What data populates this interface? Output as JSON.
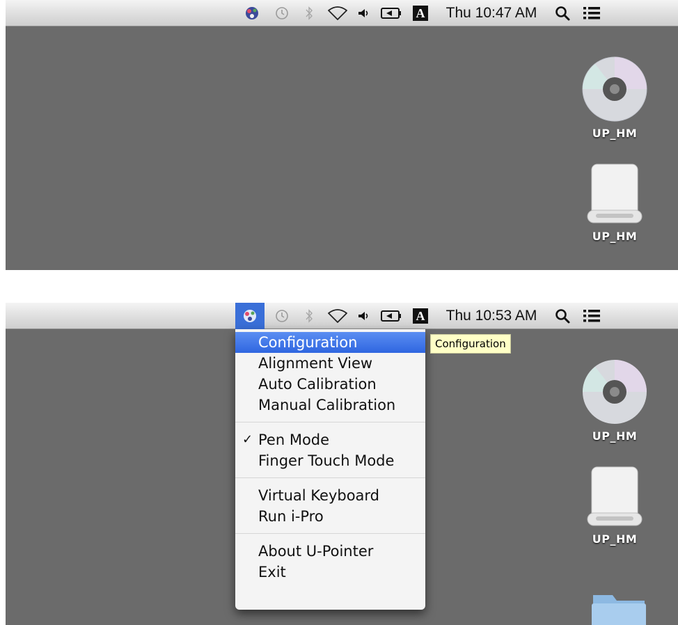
{
  "top_screenshot": {
    "menubar": {
      "icons": [
        "u-pointer-icon",
        "time-machine-icon",
        "bluetooth-icon",
        "wifi-icon",
        "volume-icon",
        "battery-icon",
        "input-source-icon",
        "spotlight-icon",
        "notification-list-icon"
      ],
      "input_source_letter": "A",
      "clock": "Thu 10:47 AM"
    },
    "desktop": [
      {
        "type": "disc-icon",
        "label": "UP_HM"
      },
      {
        "type": "drive-icon",
        "label": "UP_HM"
      }
    ]
  },
  "bottom_screenshot": {
    "menubar": {
      "icons": [
        "u-pointer-icon",
        "time-machine-icon",
        "bluetooth-icon",
        "wifi-icon",
        "volume-icon",
        "battery-icon",
        "input-source-icon",
        "spotlight-icon",
        "notification-list-icon"
      ],
      "input_source_letter": "A",
      "clock": "Thu 10:53 AM",
      "highlighted_icon": "u-pointer-icon"
    },
    "menu": {
      "groups": [
        [
          {
            "label": "Configuration",
            "highlighted": true
          },
          {
            "label": "Alignment View"
          },
          {
            "label": "Auto Calibration"
          },
          {
            "label": "Manual Calibration"
          }
        ],
        [
          {
            "label": "Pen Mode",
            "checked": true,
            "check_glyph": "✓"
          },
          {
            "label": "Finger Touch Mode"
          }
        ],
        [
          {
            "label": "Virtual Keyboard"
          },
          {
            "label": "Run i-Pro"
          }
        ],
        [
          {
            "label": "About U-Pointer"
          },
          {
            "label": "Exit"
          }
        ]
      ]
    },
    "tooltip": "Configuration",
    "desktop": [
      {
        "type": "disc-icon",
        "label": "UP_HM"
      },
      {
        "type": "drive-icon",
        "label": "UP_HM"
      },
      {
        "type": "folder-icon",
        "label": ""
      }
    ]
  },
  "colors": {
    "desktop_bg": "#6b6b6b",
    "menu_highlight": "#3a6fd8",
    "tooltip_bg": "#ffffc6"
  }
}
